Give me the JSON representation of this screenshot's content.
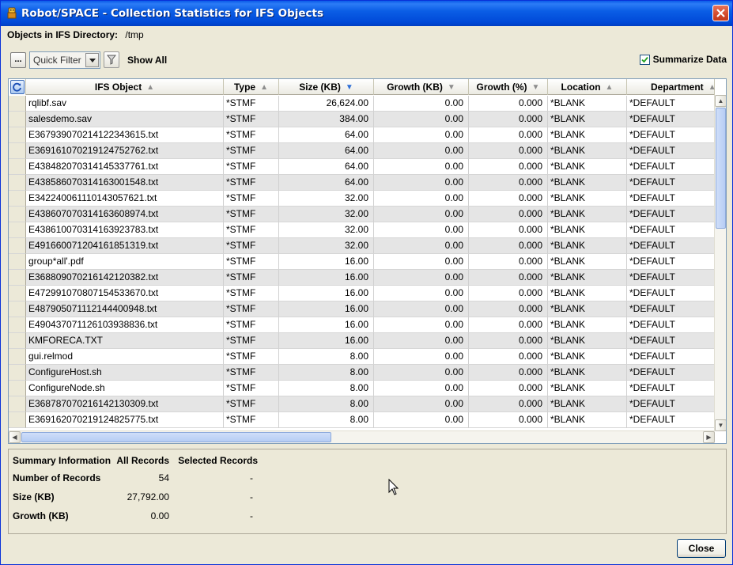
{
  "window": {
    "title": "Robot/SPACE - Collection Statistics for IFS Objects"
  },
  "directory": {
    "label": "Objects in IFS Directory:",
    "value": "/tmp"
  },
  "toolbar": {
    "ellipsis_label": "...",
    "quick_filter": "Quick Filter",
    "show_all": "Show All",
    "summarize_label": "Summarize Data",
    "summarize_checked": true
  },
  "grid": {
    "columns": [
      {
        "label": "IFS Object",
        "sort": "asc"
      },
      {
        "label": "Type",
        "sort": "asc"
      },
      {
        "label": "Size (KB)",
        "sort": "desc-active"
      },
      {
        "label": "Growth (KB)",
        "sort": "desc"
      },
      {
        "label": "Growth (%)",
        "sort": "desc"
      },
      {
        "label": "Location",
        "sort": "asc"
      },
      {
        "label": "Department",
        "sort": "asc"
      }
    ],
    "rows": [
      [
        "rqlibf.sav",
        "*STMF",
        "26,624.00",
        "0.00",
        "0.000",
        "*BLANK",
        "*DEFAULT"
      ],
      [
        "salesdemo.sav",
        "*STMF",
        "384.00",
        "0.00",
        "0.000",
        "*BLANK",
        "*DEFAULT"
      ],
      [
        "E36793907021412234361​5.txt",
        "*STMF",
        "64.00",
        "0.00",
        "0.000",
        "*BLANK",
        "*DEFAULT"
      ],
      [
        "E369161070219124752762.txt",
        "*STMF",
        "64.00",
        "0.00",
        "0.000",
        "*BLANK",
        "*DEFAULT"
      ],
      [
        "E438482070314145337761.txt",
        "*STMF",
        "64.00",
        "0.00",
        "0.000",
        "*BLANK",
        "*DEFAULT"
      ],
      [
        "E438586070314163001548.txt",
        "*STMF",
        "64.00",
        "0.00",
        "0.000",
        "*BLANK",
        "*DEFAULT"
      ],
      [
        "E342240061110143057621.txt",
        "*STMF",
        "32.00",
        "0.00",
        "0.000",
        "*BLANK",
        "*DEFAULT"
      ],
      [
        "E438607070314163608974.txt",
        "*STMF",
        "32.00",
        "0.00",
        "0.000",
        "*BLANK",
        "*DEFAULT"
      ],
      [
        "E438610070314163923783.txt",
        "*STMF",
        "32.00",
        "0.00",
        "0.000",
        "*BLANK",
        "*DEFAULT"
      ],
      [
        "E491660071204161851319.txt",
        "*STMF",
        "32.00",
        "0.00",
        "0.000",
        "*BLANK",
        "*DEFAULT"
      ],
      [
        "group*all'.pdf",
        "*STMF",
        "16.00",
        "0.00",
        "0.000",
        "*BLANK",
        "*DEFAULT"
      ],
      [
        "E368809070216142120382.txt",
        "*STMF",
        "16.00",
        "0.00",
        "0.000",
        "*BLANK",
        "*DEFAULT"
      ],
      [
        "E472991070807154533670.txt",
        "*STMF",
        "16.00",
        "0.00",
        "0.000",
        "*BLANK",
        "*DEFAULT"
      ],
      [
        "E487905071112144400948.txt",
        "*STMF",
        "16.00",
        "0.00",
        "0.000",
        "*BLANK",
        "*DEFAULT"
      ],
      [
        "E490437071126103938836.txt",
        "*STMF",
        "16.00",
        "0.00",
        "0.000",
        "*BLANK",
        "*DEFAULT"
      ],
      [
        "KMFORECA.TXT",
        "*STMF",
        "16.00",
        "0.00",
        "0.000",
        "*BLANK",
        "*DEFAULT"
      ],
      [
        "gui.relmod",
        "*STMF",
        "8.00",
        "0.00",
        "0.000",
        "*BLANK",
        "*DEFAULT"
      ],
      [
        "ConfigureHost.sh",
        "*STMF",
        "8.00",
        "0.00",
        "0.000",
        "*BLANK",
        "*DEFAULT"
      ],
      [
        "ConfigureNode.sh",
        "*STMF",
        "8.00",
        "0.00",
        "0.000",
        "*BLANK",
        "*DEFAULT"
      ],
      [
        "E368787070216142130309.txt",
        "*STMF",
        "8.00",
        "0.00",
        "0.000",
        "*BLANK",
        "*DEFAULT"
      ],
      [
        "E369162070219124825775.txt",
        "*STMF",
        "8.00",
        "0.00",
        "0.000",
        "*BLANK",
        "*DEFAULT"
      ]
    ]
  },
  "summary": {
    "headers": [
      "Summary Information",
      "All Records",
      "Selected Records"
    ],
    "rows": [
      [
        "Number of Records",
        "54",
        "-"
      ],
      [
        "Size (KB)",
        "27,792.00",
        "-"
      ],
      [
        "Growth (KB)",
        "0.00",
        "-"
      ]
    ]
  },
  "footer": {
    "close_label": "Close"
  },
  "colors": {
    "titlebar": "#0049d8",
    "window_bg": "#ece9d8",
    "sort_active": "#2f6fd6"
  }
}
